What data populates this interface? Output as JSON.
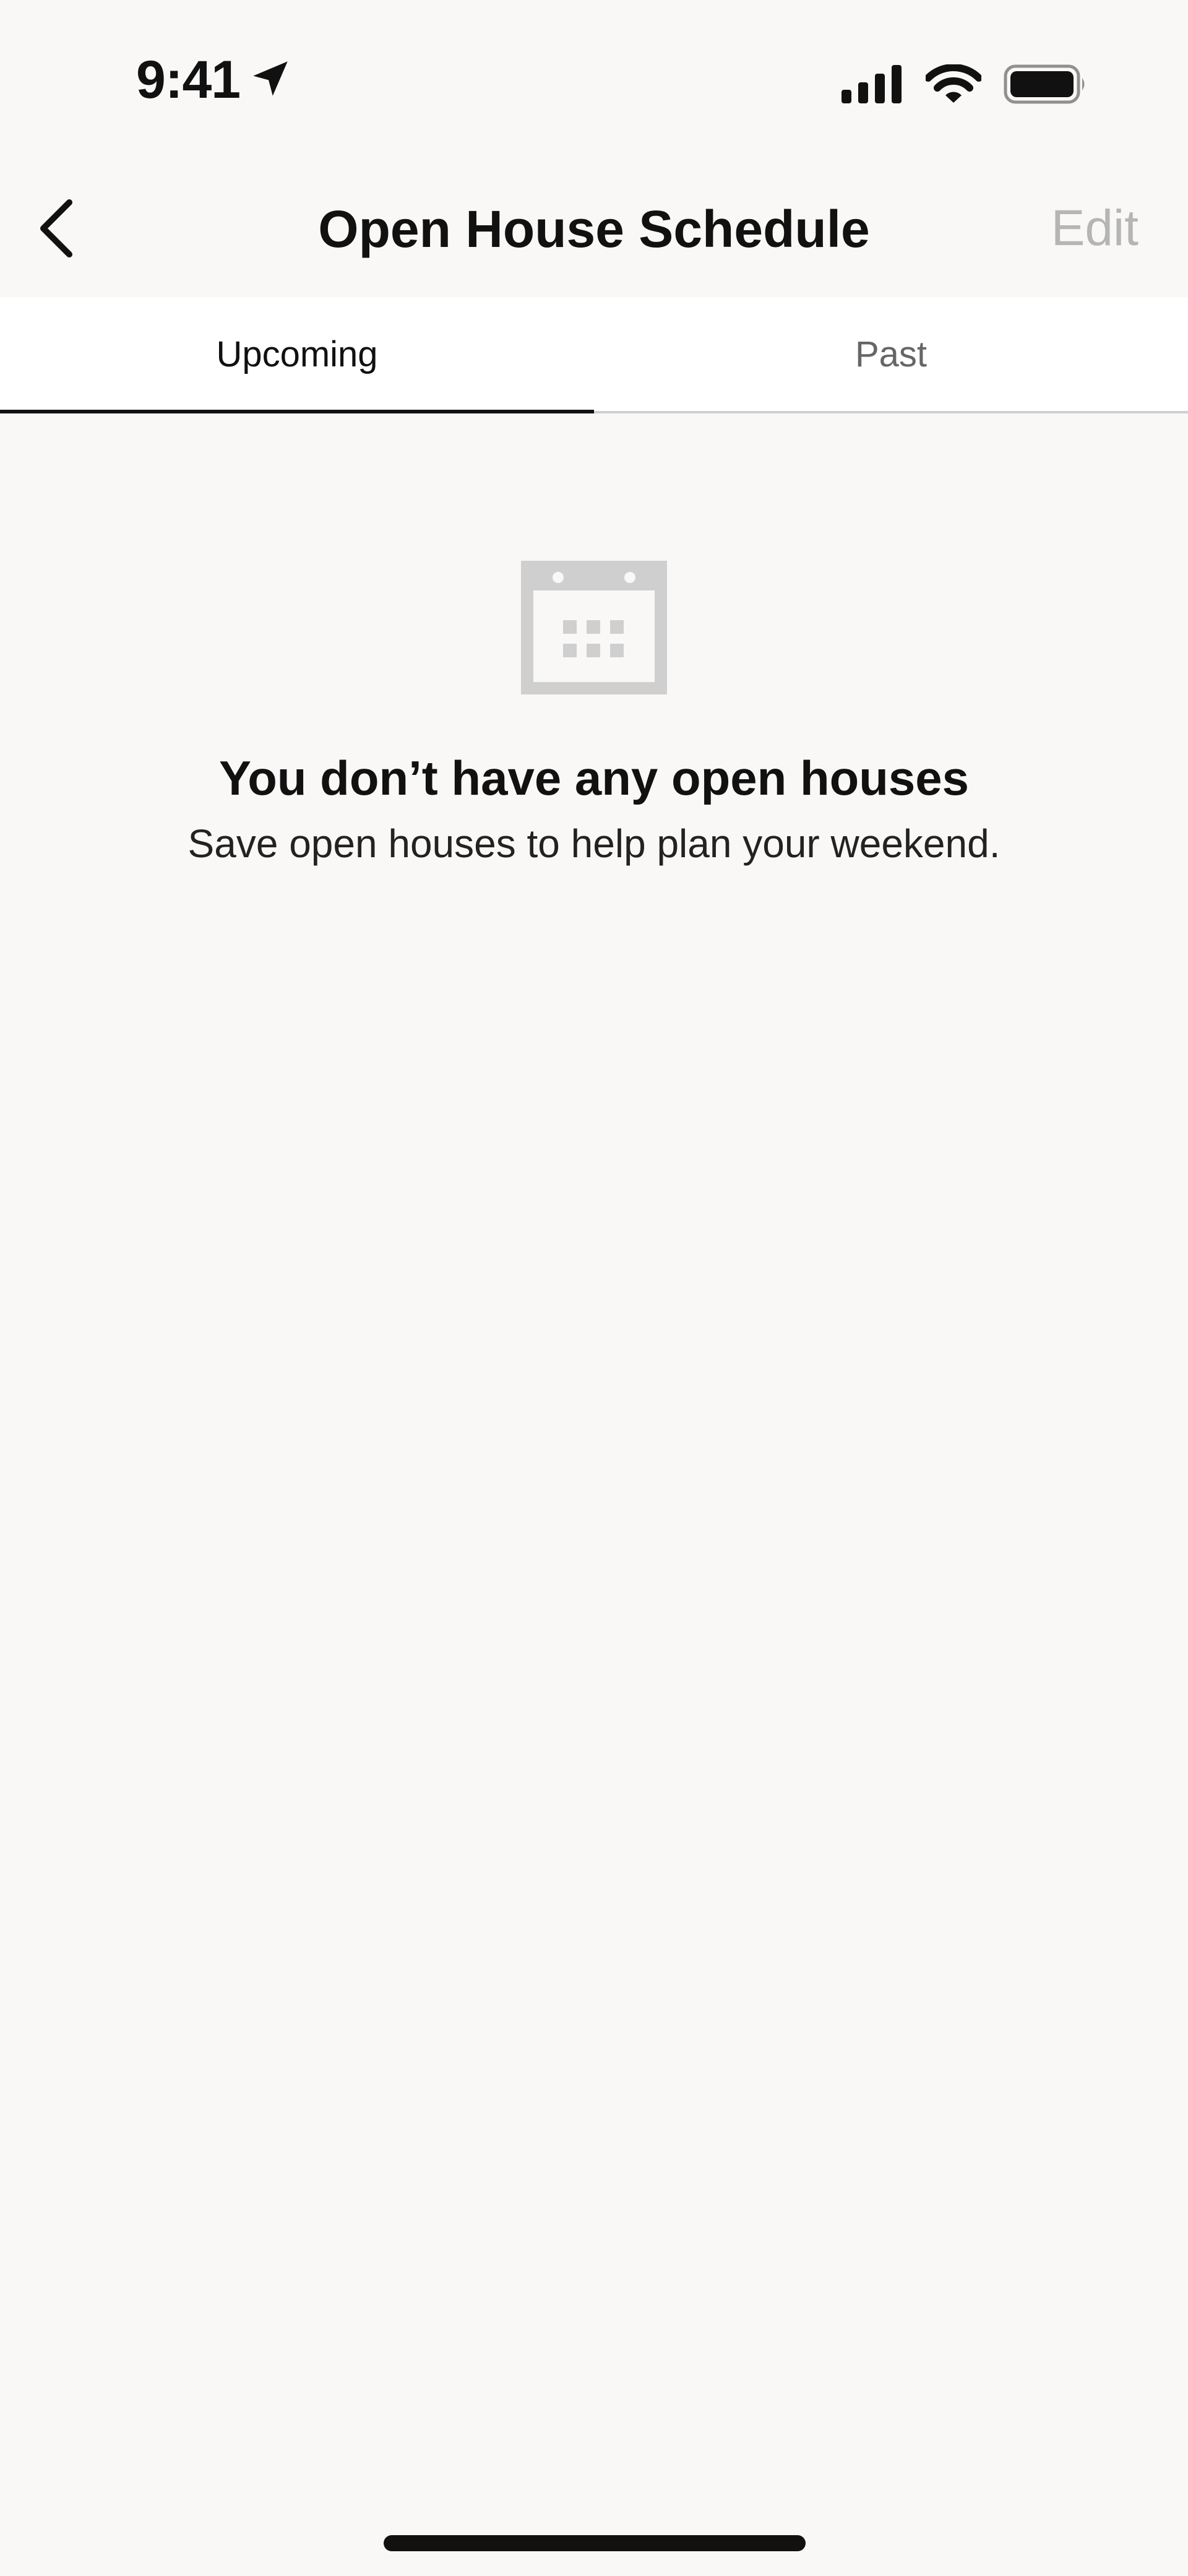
{
  "status_bar": {
    "time": "9:41",
    "icons": [
      "location-arrow-icon",
      "cellular-signal-icon",
      "wifi-icon",
      "battery-icon"
    ]
  },
  "nav": {
    "title": "Open House Schedule",
    "edit_label": "Edit",
    "back_icon": "chevron-left-icon"
  },
  "tabs": [
    {
      "label": "Upcoming",
      "active": true
    },
    {
      "label": "Past",
      "active": false
    }
  ],
  "empty_state": {
    "icon": "calendar-icon",
    "title": "You don’t have any open houses",
    "subtitle": "Save open houses to help plan your weekend."
  },
  "colors": {
    "background": "#f9f8f6",
    "tab_background": "#ffffff",
    "active_indicator": "#111111",
    "edit_disabled": "#b5b5b5",
    "icon_gray": "#cfcfcf"
  }
}
